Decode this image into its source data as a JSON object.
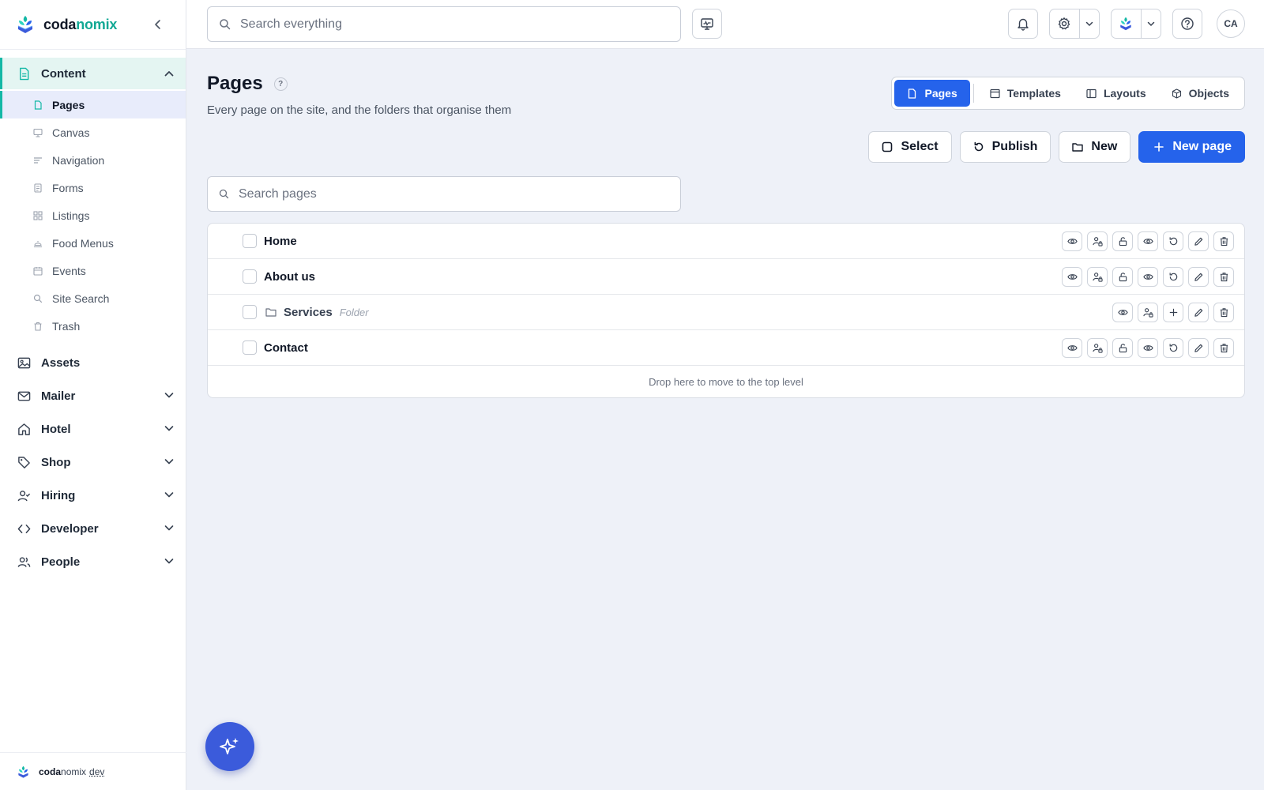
{
  "brand": {
    "name_part1": "coda",
    "name_part2": "nomix",
    "accent": "#14b8a6"
  },
  "footer": {
    "part1": "coda",
    "part2": "nomix",
    "env": "dev"
  },
  "search": {
    "placeholder": "Search everything"
  },
  "topbar": {
    "avatar": "CA",
    "icons": [
      "monitor-icon",
      "bell-icon",
      "gear-icon",
      "brand-switcher-icon",
      "help-icon"
    ]
  },
  "sidebar": {
    "content": {
      "label": "Content",
      "items": [
        {
          "label": "Pages",
          "icon": "file-icon"
        },
        {
          "label": "Canvas",
          "icon": "canvas-icon"
        },
        {
          "label": "Navigation",
          "icon": "navigation-icon"
        },
        {
          "label": "Forms",
          "icon": "form-icon"
        },
        {
          "label": "Listings",
          "icon": "grid-icon"
        },
        {
          "label": "Food Menus",
          "icon": "food-icon"
        },
        {
          "label": "Events",
          "icon": "calendar-icon"
        },
        {
          "label": "Site Search",
          "icon": "search-icon"
        },
        {
          "label": "Trash",
          "icon": "trash-icon"
        }
      ]
    },
    "groups": [
      {
        "label": "Assets",
        "icon": "image-icon"
      },
      {
        "label": "Mailer",
        "icon": "mail-icon"
      },
      {
        "label": "Hotel",
        "icon": "home-icon"
      },
      {
        "label": "Shop",
        "icon": "tag-icon"
      },
      {
        "label": "Hiring",
        "icon": "user-check-icon"
      },
      {
        "label": "Developer",
        "icon": "code-icon"
      },
      {
        "label": "People",
        "icon": "users-icon"
      }
    ]
  },
  "page": {
    "title": "Pages",
    "help": "?",
    "subtitle": "Every page on the site, and the folders that organise them"
  },
  "tabs": [
    {
      "label": "Pages",
      "active": true
    },
    {
      "label": "Templates"
    },
    {
      "label": "Layouts"
    },
    {
      "label": "Objects"
    }
  ],
  "actions": {
    "select": "Select",
    "publish": "Publish",
    "new": "New",
    "new_page": "New page"
  },
  "pages_search": {
    "placeholder": "Search pages"
  },
  "tree": {
    "rows": [
      {
        "title": "Home",
        "type": "page"
      },
      {
        "title": "About us",
        "type": "page"
      },
      {
        "title": "Services",
        "type": "folder",
        "tag": "Folder"
      },
      {
        "title": "Contact",
        "type": "page"
      }
    ],
    "drop_hint": "Drop here to move to the top level"
  },
  "colors": {
    "primary": "#2563eb",
    "active_bg": "#e4f5f2",
    "fab": "#3b5bdb"
  }
}
